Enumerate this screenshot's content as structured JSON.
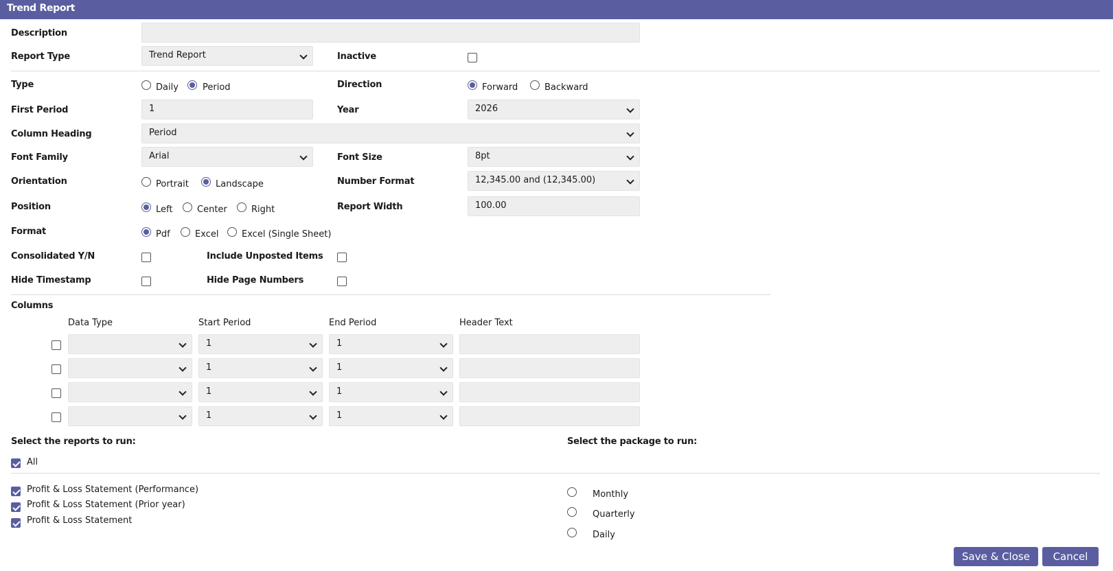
{
  "window": {
    "title": "Trend Report"
  },
  "form": {
    "description": {
      "label": "Description",
      "value": ""
    },
    "report_type": {
      "label": "Report Type",
      "value": "Trend Report"
    },
    "inactive": {
      "label": "Inactive",
      "checked": false
    },
    "type": {
      "label": "Type",
      "options": [
        "Daily",
        "Period"
      ],
      "selected": "Period"
    },
    "direction": {
      "label": "Direction",
      "options": [
        "Forward",
        "Backward"
      ],
      "selected": "Forward"
    },
    "first_period": {
      "label": "First Period",
      "value": "1"
    },
    "year": {
      "label": "Year",
      "value": "2026"
    },
    "column_heading": {
      "label": "Column Heading",
      "value": "Period"
    },
    "font_family": {
      "label": "Font Family",
      "value": "Arial"
    },
    "font_size": {
      "label": "Font Size",
      "value": "8pt"
    },
    "orientation": {
      "label": "Orientation",
      "options": [
        "Portrait",
        "Landscape"
      ],
      "selected": "Landscape"
    },
    "number_format": {
      "label": "Number Format",
      "value": "12,345.00 and (12,345.00)"
    },
    "position": {
      "label": "Position",
      "options": [
        "Left",
        "Center",
        "Right"
      ],
      "selected": "Left"
    },
    "report_width": {
      "label": "Report Width",
      "value": "100.00"
    },
    "format": {
      "label": "Format",
      "options": [
        "Pdf",
        "Excel",
        "Excel (Single Sheet)"
      ],
      "selected": "Pdf"
    },
    "consolidated": {
      "label": "Consolidated Y/N",
      "checked": false
    },
    "include_unposted": {
      "label": "Include Unposted Items",
      "checked": false
    },
    "hide_timestamp": {
      "label": "Hide Timestamp",
      "checked": false
    },
    "hide_page_numbers": {
      "label": "Hide Page Numbers",
      "checked": false
    }
  },
  "columns": {
    "label": "Columns",
    "headers": {
      "data_type": "Data Type",
      "start_period": "Start Period",
      "end_period": "End Period",
      "header_text": "Header Text"
    },
    "rows": [
      {
        "checked": false,
        "data_type": "",
        "start_period": "1",
        "end_period": "1",
        "header_text": ""
      },
      {
        "checked": false,
        "data_type": "",
        "start_period": "1",
        "end_period": "1",
        "header_text": ""
      },
      {
        "checked": false,
        "data_type": "",
        "start_period": "1",
        "end_period": "1",
        "header_text": ""
      },
      {
        "checked": false,
        "data_type": "",
        "start_period": "1",
        "end_period": "1",
        "header_text": ""
      }
    ]
  },
  "reports": {
    "label": "Select the reports to run:",
    "all_label": "All",
    "all_checked": true,
    "items": [
      {
        "label": "Profit & Loss Statement (Performance)",
        "checked": true
      },
      {
        "label": "Profit & Loss Statement (Prior year)",
        "checked": true
      },
      {
        "label": "Profit & Loss Statement",
        "checked": true
      }
    ]
  },
  "package": {
    "label": "Select the package to run:",
    "options": [
      "Monthly",
      "Quarterly",
      "Daily"
    ],
    "selected": ""
  },
  "buttons": {
    "save_close": "Save & Close",
    "cancel": "Cancel"
  },
  "colors": {
    "accent": "#5a5ea0",
    "field_bg": "#eeeeee"
  }
}
